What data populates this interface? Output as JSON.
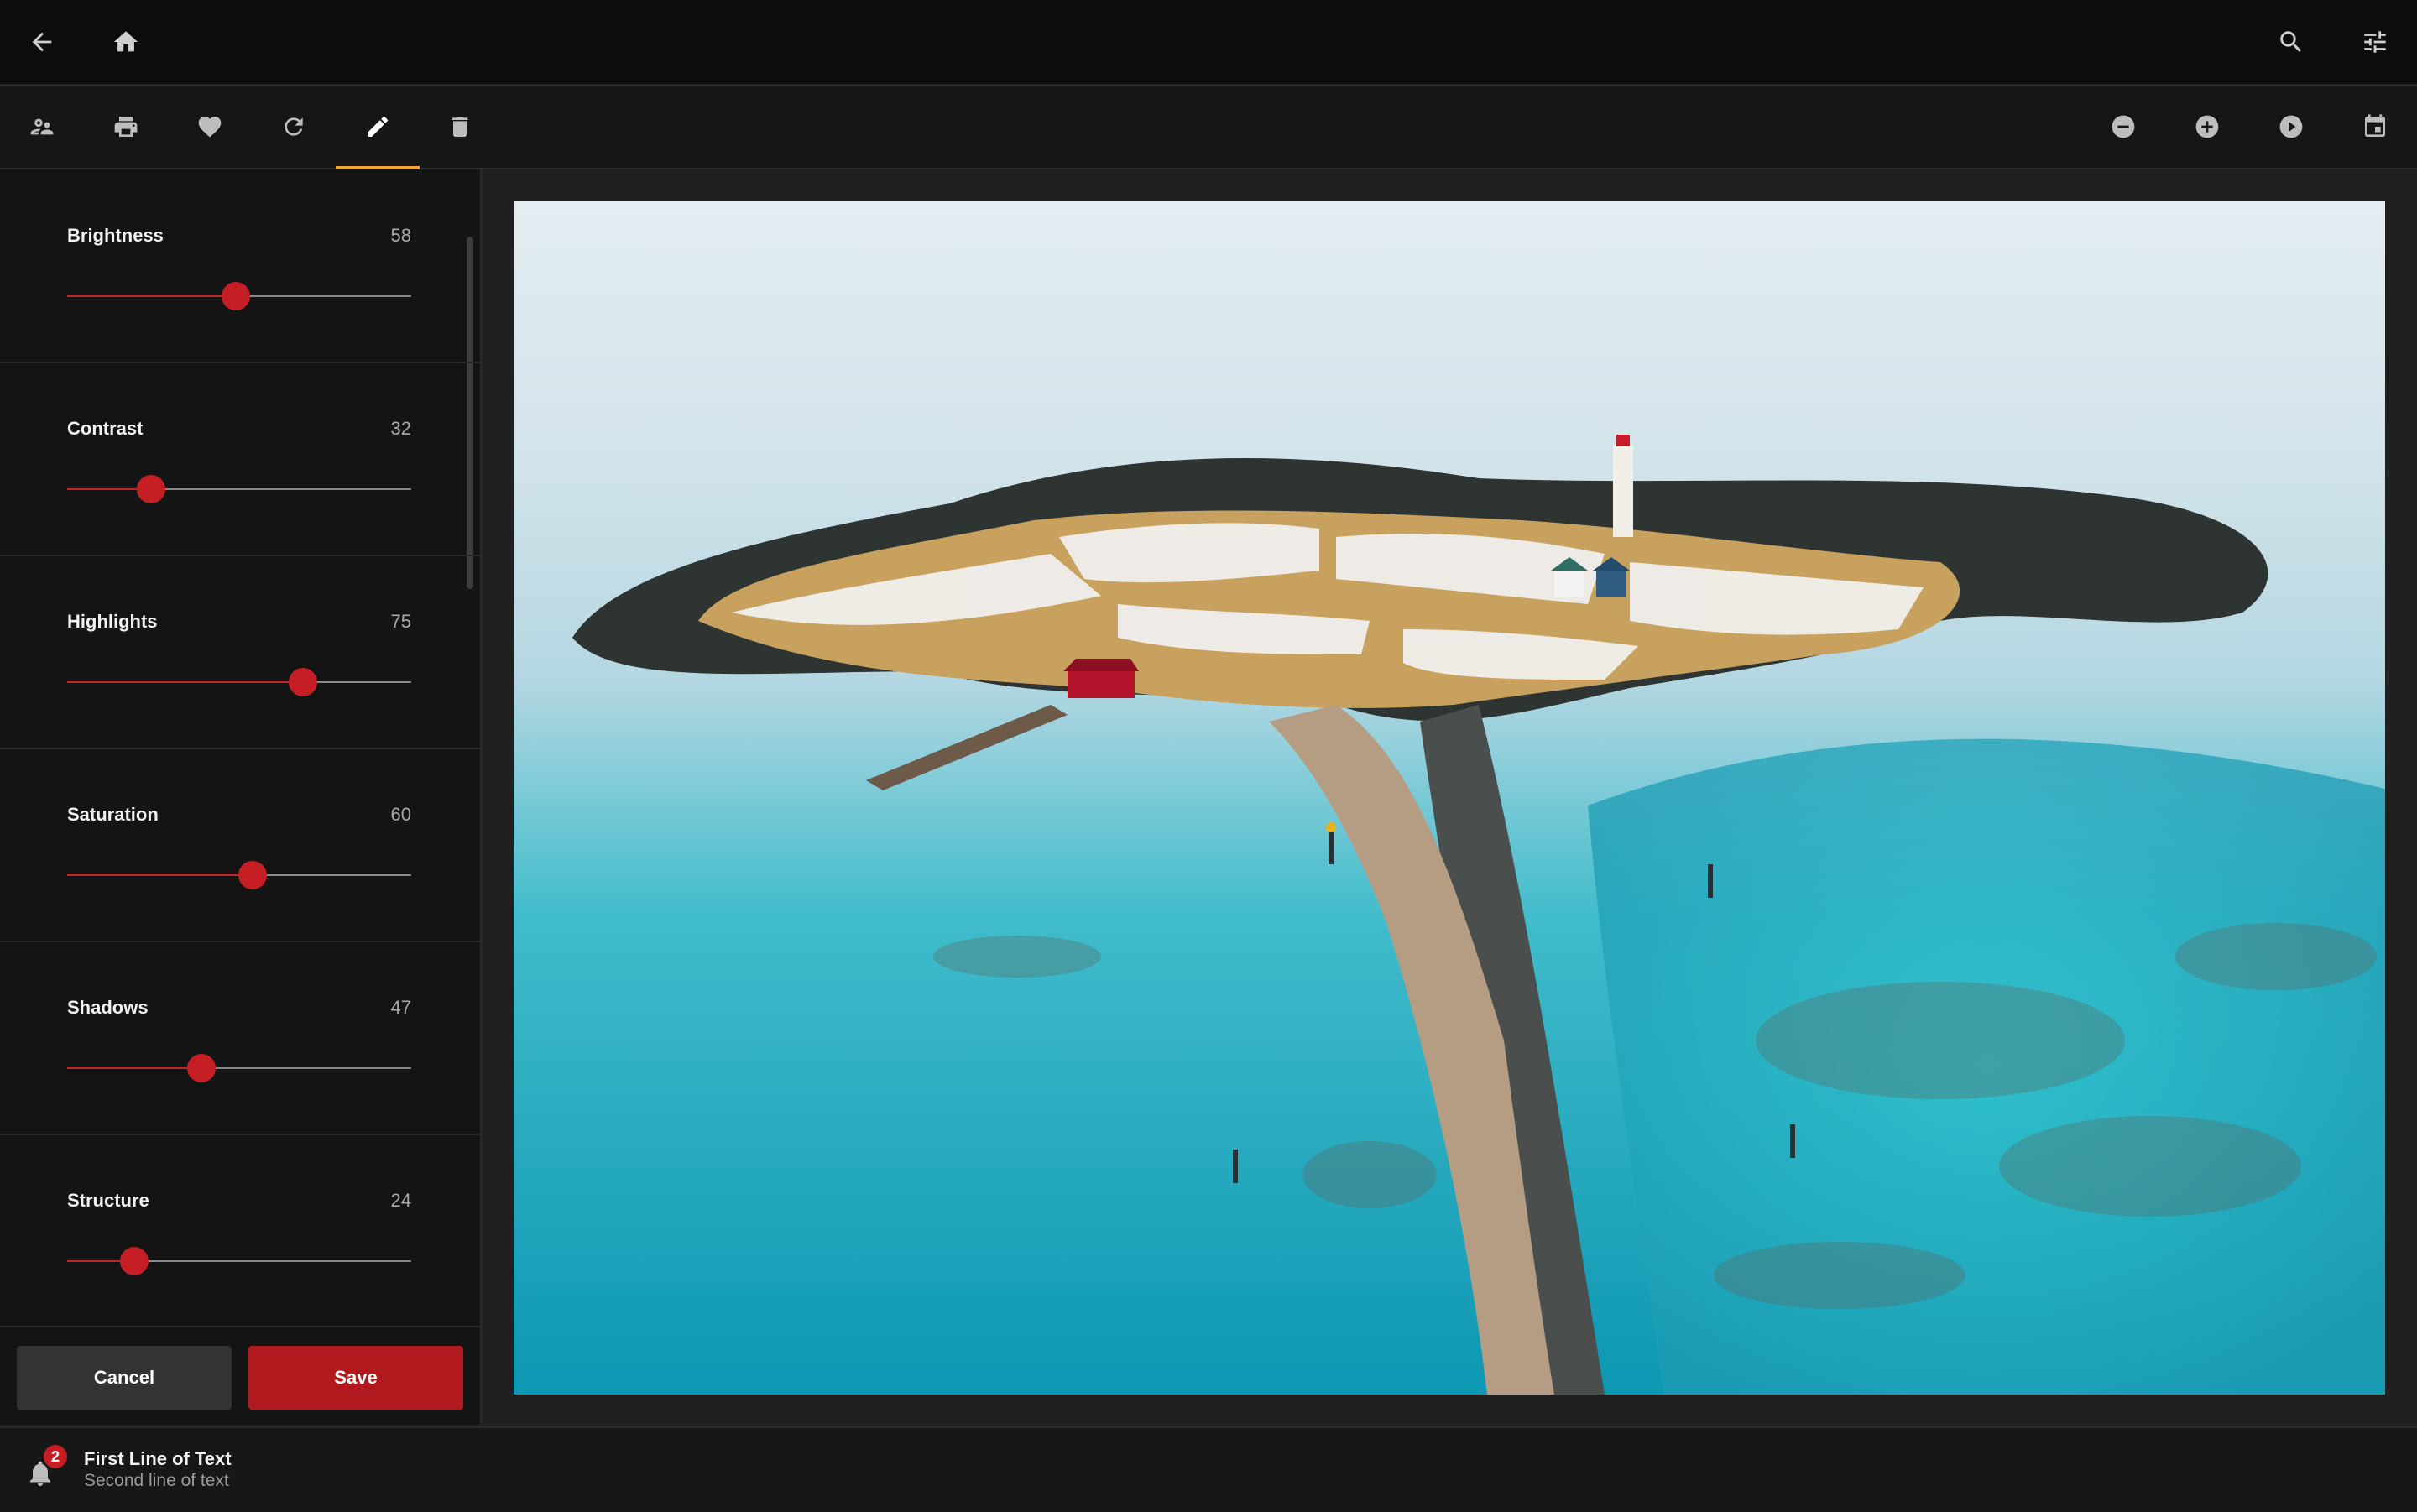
{
  "icons": {
    "back": "arrow-left-icon",
    "home": "home-icon",
    "search": "search-icon",
    "filters": "sliders-icon",
    "people": "people-icon",
    "print": "printer-icon",
    "favorite": "heart-icon",
    "rotate": "refresh-icon",
    "edit": "pencil-icon",
    "delete": "trash-icon",
    "zoom_out": "minus-circle-icon",
    "zoom_in": "plus-circle-icon",
    "slideshow": "play-circle-icon",
    "calendar": "calendar-icon",
    "notifications": "bell-icon"
  },
  "colors": {
    "accent": "#c51f25",
    "active_tab": "#f2a33a",
    "background": "#202020"
  },
  "adjustments": [
    {
      "label": "Brightness",
      "value": "58",
      "level": 0.49
    },
    {
      "label": "Contrast",
      "value": "32",
      "level": 0.245
    },
    {
      "label": "Highlights",
      "value": "75",
      "level": 0.685
    },
    {
      "label": "Saturation",
      "value": "60",
      "level": 0.54
    },
    {
      "label": "Shadows",
      "value": "47",
      "level": 0.39
    },
    {
      "label": "Structure",
      "value": "24",
      "level": 0.195
    }
  ],
  "actions": {
    "cancel": "Cancel",
    "save": "Save"
  },
  "notification": {
    "count": "2",
    "line1": "First Line of Text",
    "line2": "Second line of text"
  }
}
